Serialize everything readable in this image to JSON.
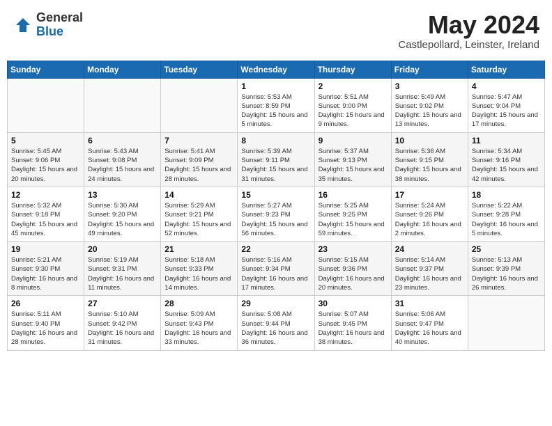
{
  "header": {
    "logo_general": "General",
    "logo_blue": "Blue",
    "month_year": "May 2024",
    "location": "Castlepollard, Leinster, Ireland"
  },
  "weekdays": [
    "Sunday",
    "Monday",
    "Tuesday",
    "Wednesday",
    "Thursday",
    "Friday",
    "Saturday"
  ],
  "weeks": [
    [
      {
        "day": "",
        "detail": ""
      },
      {
        "day": "",
        "detail": ""
      },
      {
        "day": "",
        "detail": ""
      },
      {
        "day": "1",
        "detail": "Sunrise: 5:53 AM\nSunset: 8:59 PM\nDaylight: 15 hours\nand 5 minutes."
      },
      {
        "day": "2",
        "detail": "Sunrise: 5:51 AM\nSunset: 9:00 PM\nDaylight: 15 hours\nand 9 minutes."
      },
      {
        "day": "3",
        "detail": "Sunrise: 5:49 AM\nSunset: 9:02 PM\nDaylight: 15 hours\nand 13 minutes."
      },
      {
        "day": "4",
        "detail": "Sunrise: 5:47 AM\nSunset: 9:04 PM\nDaylight: 15 hours\nand 17 minutes."
      }
    ],
    [
      {
        "day": "5",
        "detail": "Sunrise: 5:45 AM\nSunset: 9:06 PM\nDaylight: 15 hours\nand 20 minutes."
      },
      {
        "day": "6",
        "detail": "Sunrise: 5:43 AM\nSunset: 9:08 PM\nDaylight: 15 hours\nand 24 minutes."
      },
      {
        "day": "7",
        "detail": "Sunrise: 5:41 AM\nSunset: 9:09 PM\nDaylight: 15 hours\nand 28 minutes."
      },
      {
        "day": "8",
        "detail": "Sunrise: 5:39 AM\nSunset: 9:11 PM\nDaylight: 15 hours\nand 31 minutes."
      },
      {
        "day": "9",
        "detail": "Sunrise: 5:37 AM\nSunset: 9:13 PM\nDaylight: 15 hours\nand 35 minutes."
      },
      {
        "day": "10",
        "detail": "Sunrise: 5:36 AM\nSunset: 9:15 PM\nDaylight: 15 hours\nand 38 minutes."
      },
      {
        "day": "11",
        "detail": "Sunrise: 5:34 AM\nSunset: 9:16 PM\nDaylight: 15 hours\nand 42 minutes."
      }
    ],
    [
      {
        "day": "12",
        "detail": "Sunrise: 5:32 AM\nSunset: 9:18 PM\nDaylight: 15 hours\nand 45 minutes."
      },
      {
        "day": "13",
        "detail": "Sunrise: 5:30 AM\nSunset: 9:20 PM\nDaylight: 15 hours\nand 49 minutes."
      },
      {
        "day": "14",
        "detail": "Sunrise: 5:29 AM\nSunset: 9:21 PM\nDaylight: 15 hours\nand 52 minutes."
      },
      {
        "day": "15",
        "detail": "Sunrise: 5:27 AM\nSunset: 9:23 PM\nDaylight: 15 hours\nand 56 minutes."
      },
      {
        "day": "16",
        "detail": "Sunrise: 5:25 AM\nSunset: 9:25 PM\nDaylight: 15 hours\nand 59 minutes."
      },
      {
        "day": "17",
        "detail": "Sunrise: 5:24 AM\nSunset: 9:26 PM\nDaylight: 16 hours\nand 2 minutes."
      },
      {
        "day": "18",
        "detail": "Sunrise: 5:22 AM\nSunset: 9:28 PM\nDaylight: 16 hours\nand 5 minutes."
      }
    ],
    [
      {
        "day": "19",
        "detail": "Sunrise: 5:21 AM\nSunset: 9:30 PM\nDaylight: 16 hours\nand 8 minutes."
      },
      {
        "day": "20",
        "detail": "Sunrise: 5:19 AM\nSunset: 9:31 PM\nDaylight: 16 hours\nand 11 minutes."
      },
      {
        "day": "21",
        "detail": "Sunrise: 5:18 AM\nSunset: 9:33 PM\nDaylight: 16 hours\nand 14 minutes."
      },
      {
        "day": "22",
        "detail": "Sunrise: 5:16 AM\nSunset: 9:34 PM\nDaylight: 16 hours\nand 17 minutes."
      },
      {
        "day": "23",
        "detail": "Sunrise: 5:15 AM\nSunset: 9:36 PM\nDaylight: 16 hours\nand 20 minutes."
      },
      {
        "day": "24",
        "detail": "Sunrise: 5:14 AM\nSunset: 9:37 PM\nDaylight: 16 hours\nand 23 minutes."
      },
      {
        "day": "25",
        "detail": "Sunrise: 5:13 AM\nSunset: 9:39 PM\nDaylight: 16 hours\nand 26 minutes."
      }
    ],
    [
      {
        "day": "26",
        "detail": "Sunrise: 5:11 AM\nSunset: 9:40 PM\nDaylight: 16 hours\nand 28 minutes."
      },
      {
        "day": "27",
        "detail": "Sunrise: 5:10 AM\nSunset: 9:42 PM\nDaylight: 16 hours\nand 31 minutes."
      },
      {
        "day": "28",
        "detail": "Sunrise: 5:09 AM\nSunset: 9:43 PM\nDaylight: 16 hours\nand 33 minutes."
      },
      {
        "day": "29",
        "detail": "Sunrise: 5:08 AM\nSunset: 9:44 PM\nDaylight: 16 hours\nand 36 minutes."
      },
      {
        "day": "30",
        "detail": "Sunrise: 5:07 AM\nSunset: 9:45 PM\nDaylight: 16 hours\nand 38 minutes."
      },
      {
        "day": "31",
        "detail": "Sunrise: 5:06 AM\nSunset: 9:47 PM\nDaylight: 16 hours\nand 40 minutes."
      },
      {
        "day": "",
        "detail": ""
      }
    ]
  ]
}
